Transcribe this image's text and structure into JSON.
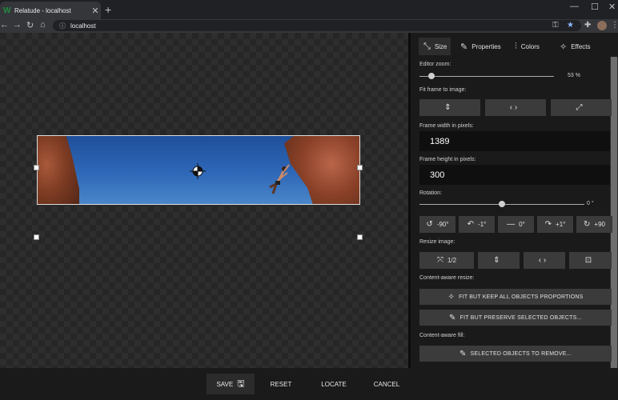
{
  "browser": {
    "tab_title": "Relatude - localhost",
    "favicon": "W",
    "address": "localhost",
    "icons": {
      "close": "✕",
      "new_tab": "+",
      "minimize": "—",
      "maximize": "☐",
      "window_close": "✕",
      "back": "←",
      "forward": "→",
      "reload": "↻",
      "home": "⌂",
      "info": "ⓘ",
      "key": "⚿",
      "star": "★",
      "extensions": "✚",
      "more": "⋮"
    }
  },
  "panel": {
    "tabs": [
      {
        "label": "Size",
        "icon": "⤡"
      },
      {
        "label": "Properties",
        "icon": "✎"
      },
      {
        "label": "Colors",
        "icon": "⫶"
      },
      {
        "label": "Effects",
        "icon": "✧"
      }
    ],
    "editor_zoom_label": "Editor zoom:",
    "editor_zoom_value": "53 %",
    "editor_zoom_level": 0.09,
    "fit_frame_label": "Fit frame to image:",
    "fit_buttons": [
      {
        "icon": "⇕"
      },
      {
        "icon": "‹ ›"
      },
      {
        "icon": "⤢"
      }
    ],
    "frame_width_label": "Frame width in pixels:",
    "frame_width_value": "1389",
    "frame_height_label": "Frame height in pixels:",
    "frame_height_value": "300",
    "rotation_label": "Rotation:",
    "rotation_value": "0 °",
    "rotation_level": 0.5,
    "rotation_buttons": [
      {
        "icon": "↺",
        "label": "-90°"
      },
      {
        "icon": "↶",
        "label": "-1°"
      },
      {
        "icon": "—",
        "label": "0°"
      },
      {
        "icon": "↷",
        "label": "+1°"
      },
      {
        "icon": "↻",
        "label": "+90"
      }
    ],
    "resize_label": "Resize image:",
    "resize_buttons": [
      {
        "icon": "⤧",
        "label": "1/2"
      },
      {
        "icon": "⇕",
        "label": ""
      },
      {
        "icon": "‹ ›",
        "label": ""
      },
      {
        "icon": "⊡",
        "label": ""
      }
    ],
    "content_aware_resize_label": "Content-aware resize:",
    "fit_keep_label": "FIT BUT KEEP ALL OBJECTS PROPORTIONS",
    "fit_keep_icon": "✧",
    "fit_preserve_label": "FIT BUT PRESERVE SELECTED OBJECTS...",
    "fit_preserve_icon": "✎",
    "content_aware_fill_label": "Content-aware fill:",
    "remove_label": "SELECTED OBJECTS TO REMOVE...",
    "remove_icon": "✎"
  },
  "bottom": {
    "save_label": "SAVE",
    "save_icon": "🖫",
    "reset_label": "RESET",
    "locate_label": "LOCATE",
    "cancel_label": "CANCEL"
  }
}
